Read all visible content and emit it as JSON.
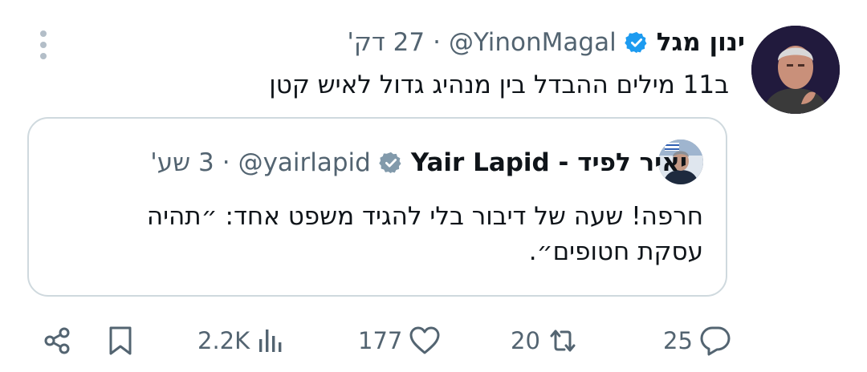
{
  "post": {
    "author_name": "ינון מגל",
    "handle": "@YinonMagal",
    "separator": "·",
    "time": "27 דק'",
    "text": "ב11 מילים ההבדל בין מנהיג גדול לאיש קטן",
    "verified_icon": "blue-verified-badge",
    "more_icon": "vertical-ellipsis"
  },
  "quoted": {
    "author_name": "יאיר לפיד - Yair Lapid",
    "handle": "@yairlapid",
    "separator": "·",
    "time": "3 שע'",
    "text": "חרפה! שעה של דיבור בלי להגיד משפט אחד: ״תהיה עסקת חטופים״.",
    "verified_icon": "gray-verified-badge"
  },
  "actions": {
    "replies": "25",
    "retweets": "20",
    "likes": "177",
    "views": "2.2K",
    "share_icon": "share-icon",
    "bookmark_icon": "bookmark-icon"
  },
  "colors": {
    "text": "#0f1419",
    "muted": "#536471",
    "verified_blue": "#1d9bf0",
    "verified_gray": "#829aab",
    "border": "#cfd9de"
  }
}
